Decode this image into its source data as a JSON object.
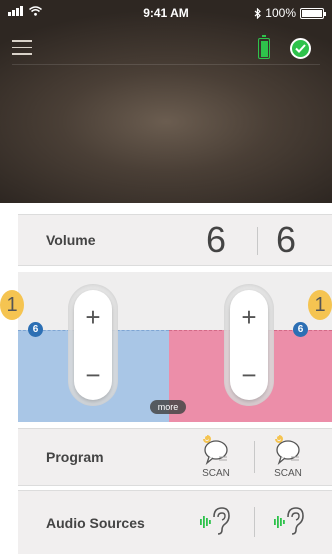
{
  "status_bar": {
    "time": "9:41 AM",
    "battery_percent": "100%",
    "bluetooth_icon": "bluetooth-icon",
    "wifi_icon": "wifi-icon",
    "signal_icon": "signal-icon"
  },
  "header": {
    "menu_icon": "hamburger-menu-icon",
    "device_battery_icon": "device-battery-icon",
    "status_icon": "check-circle-icon"
  },
  "volume": {
    "label": "Volume",
    "left_value": "6",
    "right_value": "6"
  },
  "control": {
    "left_program_number": "1",
    "right_program_number": "1",
    "left_level": "6",
    "right_level": "6",
    "more_label": "more",
    "plus_symbol": "+",
    "minus_symbol": "−"
  },
  "program": {
    "label": "Program",
    "left_scan_label": "SCAN",
    "right_scan_label": "SCAN"
  },
  "audio_sources": {
    "label": "Audio Sources"
  },
  "colors": {
    "left_side": "#a9c6e6",
    "right_side": "#ec8ea9",
    "accent_green": "#2ec24b",
    "badge_yellow": "#f5c451",
    "badge_blue": "#2c6fb4"
  }
}
